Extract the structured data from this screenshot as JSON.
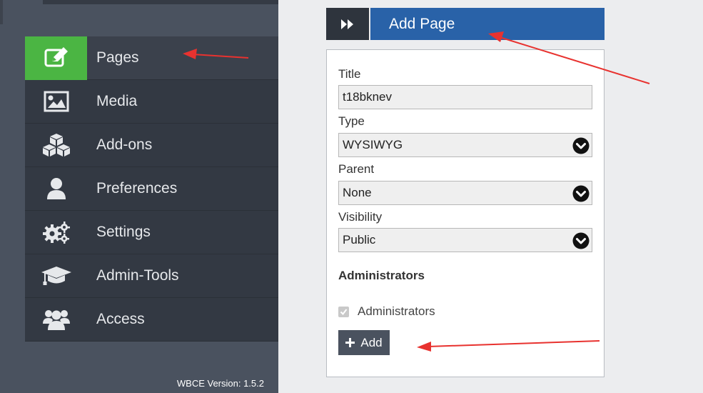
{
  "sidebar": {
    "items": [
      {
        "label": "Pages",
        "icon": "edit-icon",
        "active": true
      },
      {
        "label": "Media",
        "icon": "image-icon"
      },
      {
        "label": "Add-ons",
        "icon": "cubes-icon"
      },
      {
        "label": "Preferences",
        "icon": "user-icon"
      },
      {
        "label": "Settings",
        "icon": "gears-icon"
      },
      {
        "label": "Admin-Tools",
        "icon": "graduation-cap-icon"
      },
      {
        "label": "Access",
        "icon": "users-icon"
      }
    ],
    "version": "WBCE Version: 1.5.2"
  },
  "panel": {
    "title": "Add Page",
    "fields": {
      "title": {
        "label": "Title",
        "value": "t18bknev"
      },
      "type": {
        "label": "Type",
        "value": "WYSIWYG"
      },
      "parent": {
        "label": "Parent",
        "value": "None"
      },
      "visibility": {
        "label": "Visibility",
        "value": "Public"
      }
    },
    "admins_section": "Administrators",
    "admins_checkbox_label": "Administrators",
    "add_button": "Add"
  },
  "colors": {
    "accent_green": "#4bb543",
    "header_blue": "#2962a8",
    "annotation_red": "#e8322f"
  }
}
